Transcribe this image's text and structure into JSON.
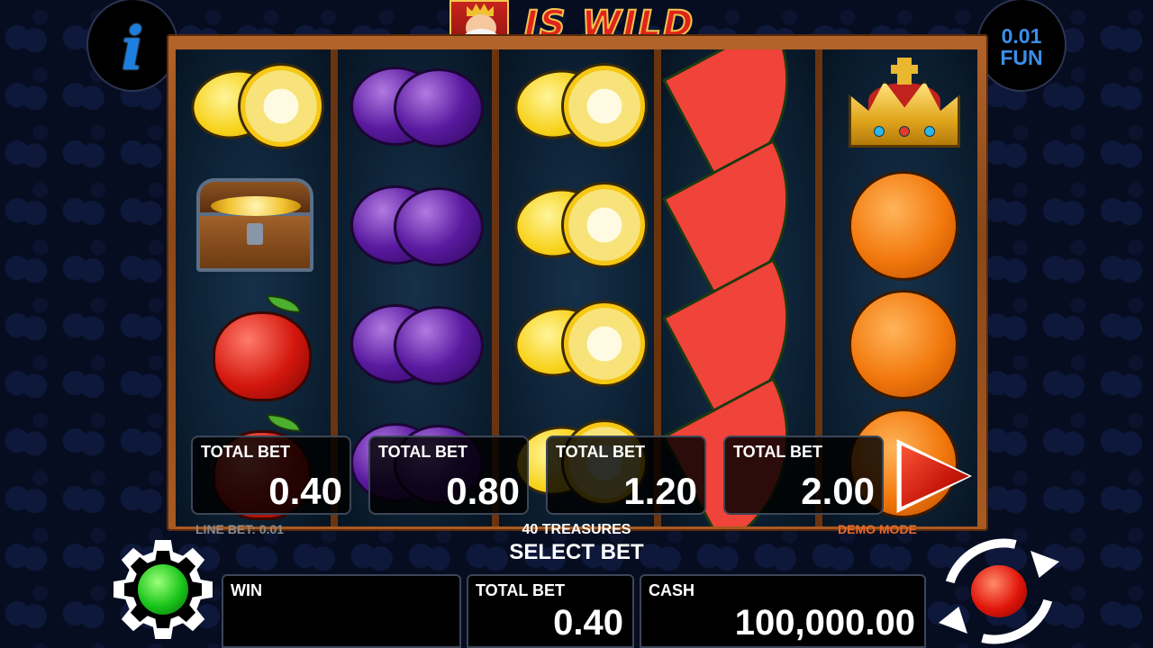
{
  "header": {
    "info_icon": "info-icon",
    "info_glyph": "i",
    "coin_value": "0.01",
    "currency": "FUN",
    "wild_text": "IS WILD",
    "wild_symbol": "king-icon"
  },
  "reels": [
    [
      "lemon",
      "chest",
      "apple",
      "apple"
    ],
    [
      "plum",
      "plum",
      "plum",
      "plum"
    ],
    [
      "lemon",
      "lemon",
      "lemon",
      "lemon"
    ],
    [
      "watermelon",
      "watermelon",
      "watermelon",
      "watermelon"
    ],
    [
      "crown",
      "orange",
      "orange",
      "orange"
    ]
  ],
  "bet_options": [
    {
      "label": "TOTAL BET",
      "value": "0.40"
    },
    {
      "label": "TOTAL BET",
      "value": "0.80"
    },
    {
      "label": "TOTAL BET",
      "value": "1.20"
    },
    {
      "label": "TOTAL BET",
      "value": "2.00"
    }
  ],
  "info_line": {
    "line_bet": "LINE BET: 0.01",
    "game_name": "40 TREASURES",
    "prompt": "SELECT BET",
    "mode": "DEMO MODE"
  },
  "bottom_bar": {
    "win_label": "WIN",
    "win_value": "",
    "total_bet_label": "TOTAL BET",
    "total_bet_value": "0.40",
    "cash_label": "CASH",
    "cash_value": "100,000.00"
  },
  "colors": {
    "accent_blue": "#3b8eea",
    "demo_orange": "#e56a2b",
    "settings_status": "#18c41a",
    "spin_red": "#e1150a"
  }
}
